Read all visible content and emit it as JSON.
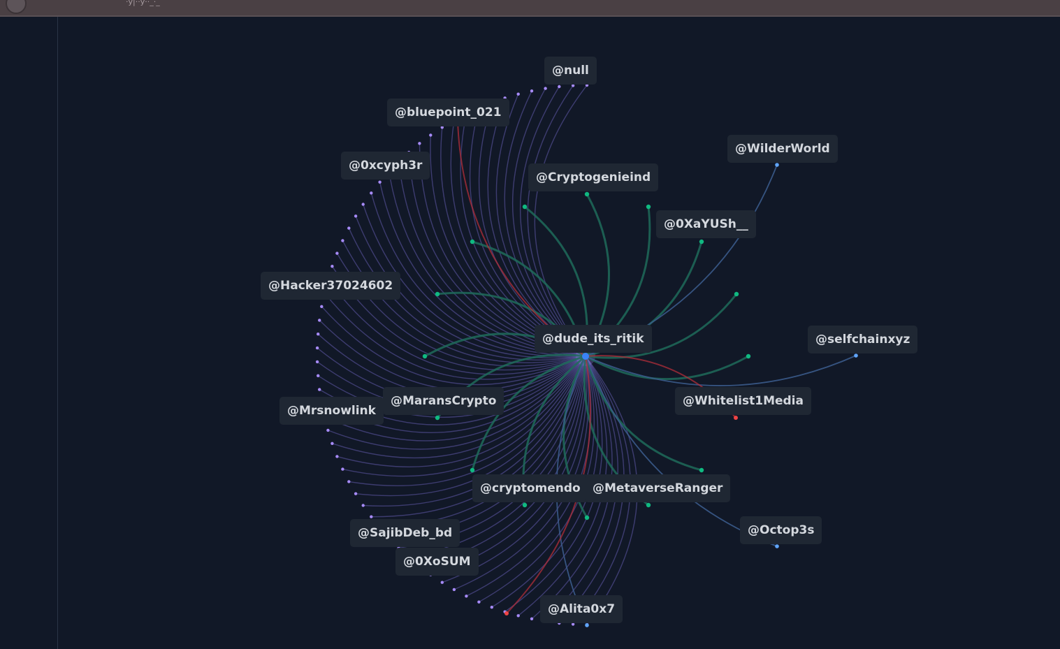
{
  "window": {
    "tab_title": "·y|··y··_·_"
  },
  "graph": {
    "colors": {
      "background": "#111827",
      "purple_edge": "#7c6fd6",
      "purple_node": "#a78bfa",
      "green_edge": "#1e6b5a",
      "green_node": "#10b981",
      "blue_edge": "#3b5b8c",
      "blue_node": "#60a5fa",
      "red_edge": "#b02e3a",
      "red_node": "#ef4444"
    },
    "center": {
      "label": "@dude_its_ritik",
      "icon": "center-node-dot"
    },
    "nodes": [
      {
        "label": "@null",
        "group": "purple"
      },
      {
        "label": "@bluepoint_021",
        "group": "purple"
      },
      {
        "label": "@0xcyph3r",
        "group": "purple"
      },
      {
        "label": "@Hacker37024602",
        "group": "purple"
      },
      {
        "label": "@Mrsnowlink",
        "group": "purple"
      },
      {
        "label": "@SajibDeb_bd",
        "group": "purple"
      },
      {
        "label": "@0XoSUM",
        "group": "purple"
      },
      {
        "label": "@Alita0x7",
        "group": "purple"
      },
      {
        "label": "@Cryptogenieind",
        "group": "green"
      },
      {
        "label": "@0XaYUSh__",
        "group": "green"
      },
      {
        "label": "@MaransCrypto",
        "group": "green"
      },
      {
        "label": "@cryptomendo",
        "group": "green"
      },
      {
        "label": "@MetaverseRanger",
        "group": "green"
      },
      {
        "label": "@WilderWorld",
        "group": "blue"
      },
      {
        "label": "@selfchainxyz",
        "group": "blue"
      },
      {
        "label": "@Octop3s",
        "group": "blue"
      },
      {
        "label": "@Whitelist1Media",
        "group": "red"
      }
    ]
  }
}
